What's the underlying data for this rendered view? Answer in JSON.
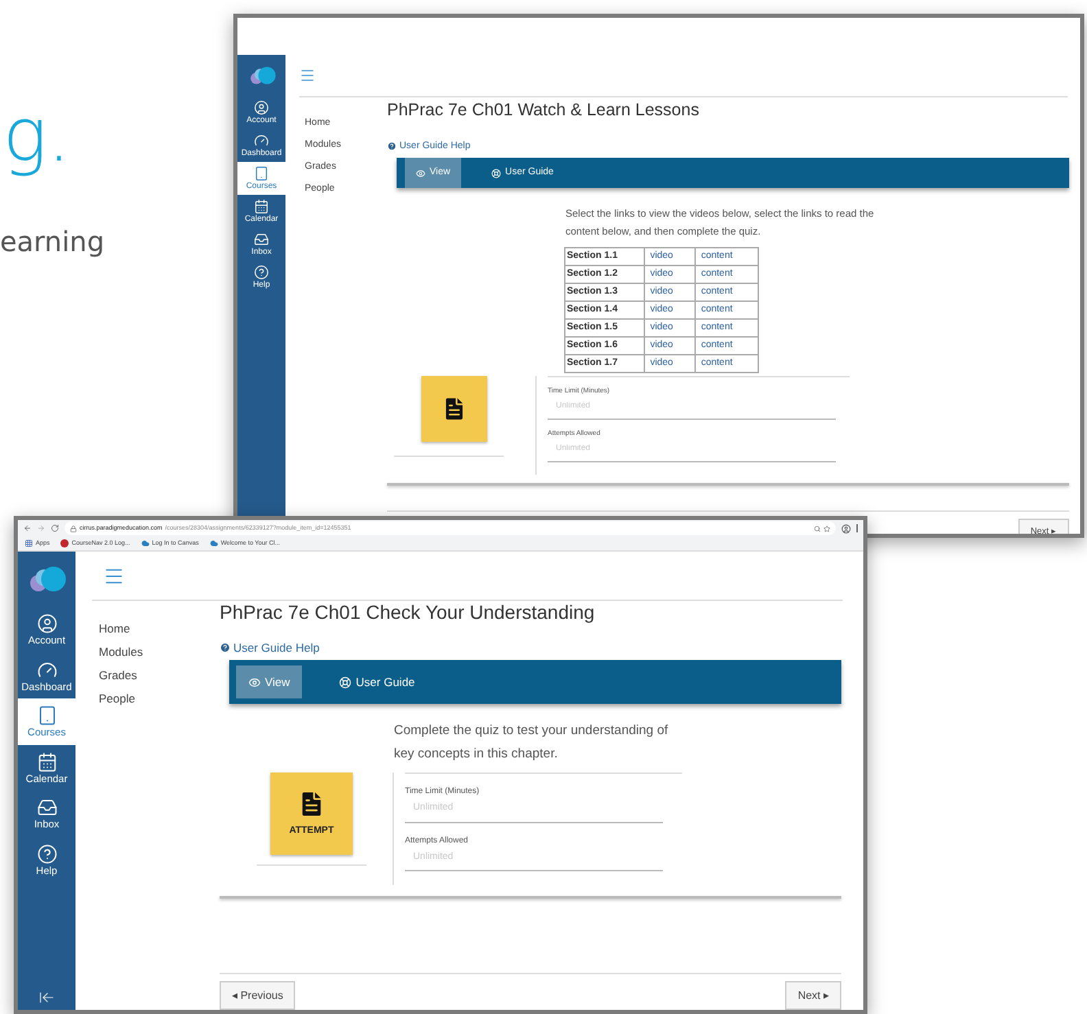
{
  "headline": "g.",
  "subheadline": "earning",
  "windows": [
    {
      "kind": "back",
      "sidebar": [
        {
          "label": "Account",
          "selected": false
        },
        {
          "label": "Dashboard",
          "selected": false
        },
        {
          "label": "Courses",
          "selected": true
        },
        {
          "label": "Calendar",
          "selected": false
        },
        {
          "label": "Inbox",
          "selected": false
        },
        {
          "label": "Help",
          "selected": false
        }
      ],
      "nav": [
        "Home",
        "Modules",
        "Grades",
        "People"
      ],
      "title": "PhPrac 7e Ch01 Watch & Learn Lessons",
      "help_link": "User Guide Help",
      "toolbar": [
        {
          "label": "View",
          "selected": true
        },
        {
          "label": "User Guide",
          "selected": false
        }
      ],
      "instructions": "Select the links to view the videos below, select the links to read the content below, and then complete the quiz.",
      "sections": [
        {
          "section": "Section 1.1",
          "video": "video",
          "content": "content"
        },
        {
          "section": "Section 1.2",
          "video": "video",
          "content": "content"
        },
        {
          "section": "Section 1.3",
          "video": "video",
          "content": "content"
        },
        {
          "section": "Section 1.4",
          "video": "video",
          "content": "content"
        },
        {
          "section": "Section 1.5",
          "video": "video",
          "content": "content"
        },
        {
          "section": "Section 1.6",
          "video": "video",
          "content": "content"
        },
        {
          "section": "Section 1.7",
          "video": "video",
          "content": "content"
        }
      ],
      "quiz_fields": [
        {
          "label": "Time Limit (Minutes)",
          "placeholder": "Unlimited"
        },
        {
          "label": "Attempts Allowed",
          "placeholder": "Unlimited"
        }
      ],
      "next": "Next ▸"
    },
    {
      "kind": "front",
      "browser": {
        "url_host": "cirrus.paradigmeducation.com",
        "url_path": "/courses/28304/assignments/62339127?module_item_id=12455351",
        "bookmarks": [
          "Apps",
          "CourseNav 2.0 Log...",
          "Log In to Canvas",
          "Welcome to Your Cl..."
        ]
      },
      "sidebar": [
        {
          "label": "Account",
          "selected": false
        },
        {
          "label": "Dashboard",
          "selected": false
        },
        {
          "label": "Courses",
          "selected": true
        },
        {
          "label": "Calendar",
          "selected": false
        },
        {
          "label": "Inbox",
          "selected": false
        },
        {
          "label": "Help",
          "selected": false
        }
      ],
      "nav": [
        "Home",
        "Modules",
        "Grades",
        "People"
      ],
      "title": "PhPrac 7e Ch01 Check Your Understanding",
      "help_link": "User Guide Help",
      "toolbar": [
        {
          "label": "View",
          "selected": true
        },
        {
          "label": "User Guide",
          "selected": false
        }
      ],
      "instructions": "Complete the quiz to test your understanding of key concepts in this chapter.",
      "tile_label": "ATTEMPT",
      "quiz_fields": [
        {
          "label": "Time Limit (Minutes)",
          "placeholder": "Unlimited"
        },
        {
          "label": "Attempts Allowed",
          "placeholder": "Unlimited"
        }
      ],
      "previous": "◂ Previous",
      "next": "Next ▸"
    }
  ]
}
